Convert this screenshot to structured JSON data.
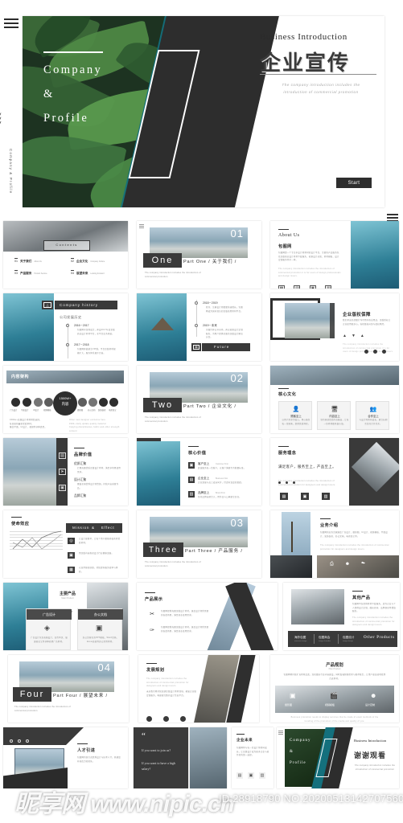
{
  "hero": {
    "brand_line1": "Company",
    "brand_line2": "&",
    "brand_line3": "Profile",
    "vertical_label": "Company  &  Profile",
    "chevrons": ">>>",
    "title_en": "Business Introduction",
    "title_cn": "企业宣传",
    "subtitle_line1": "The company introduction includes the",
    "subtitle_line2": "introduction of commercial promotion",
    "start_label": "Start"
  },
  "slides": {
    "contents": {
      "title": "Contents",
      "items": [
        {
          "no": "01",
          "cn": "关于我们",
          "en": "About Us"
        },
        {
          "no": "02",
          "cn": "企业文化",
          "en": "Company Culture"
        },
        {
          "no": "03",
          "cn": "产品服务",
          "en": "Product Service"
        },
        {
          "no": "04",
          "cn": "展望未来",
          "en": "Looking Forward"
        }
      ]
    },
    "part_one": {
      "number": "01",
      "word": "One",
      "caption": "Part One / 关于我们 /",
      "sub": "The company introduction includes the introduction of commercial promotion"
    },
    "about_us": {
      "title_en": "About Us",
      "title_cn": "包图网",
      "body": "包图网是一个专注于设计师素材的设计平台，主要的产品服务包括正版商业设计素材下载服务、创意设计灵感、素材模板、设计定制服务等于一体。",
      "body_en": "The company introduction includes the introduction of commercial promotion it is for users of design professionals and design lovers."
    },
    "history": {
      "title_en": "Company history",
      "title_cn": "公司发展历史",
      "future_label": "Future",
      "timeline": [
        {
          "year": "2016－2017",
          "text": "包图网于深圳成立，开设2017年度正版商业设计素材平台，全平台业务开始。"
        },
        {
          "year": "2017－2018",
          "text": "包图网开始建立VIP制，平台正版素材规模扩大，服务体系逐步完善。"
        },
        {
          "year": "2018－2019",
          "text": "签约、注册设计师数量快速增长，包图网成为国内领先的正版商用素材平台。"
        },
        {
          "year": "2019－未来",
          "text": "全面打开公众市场，开启创意设计定制服务，为用户提供全面的正版设计解决方案。"
        }
      ]
    },
    "copyright": {
      "title_cn": "企业版权保障",
      "body": "我们承诺全部图片均可用于商业用途，正版授权让企业使用更放心，杜绝版权纠纷与侵权风险。"
    },
    "structure": {
      "title_cn": "内容架构",
      "center_top": "1500W+",
      "center_bottom": "内容",
      "nodes_left": [
        "广告设计",
        "平面设计",
        "UI设计",
        "视频模板"
      ],
      "nodes_right": [
        "摄影图",
        "办公文档",
        "装饰装修",
        "电商淘宝"
      ],
      "notes_cn": [
        "1500w+正版设计素材供您选择。",
        "每日更新最新优质素材。",
        "覆盖平面、UI设计、视频等多种类型。"
      ],
      "notes_en": [
        "Other new designer exclusive here",
        "1500+ daily update quality material",
        "Copying disciplinaries, fabric and other strength content"
      ]
    },
    "part_two": {
      "number": "02",
      "word": "Two",
      "caption": "Part Two / 企业文化 /",
      "sub": "The company introduction includes the introduction of commercial promotion"
    },
    "core_culture": {
      "title_cn": "核心文化",
      "cards": [
        {
          "title": "顾客至上",
          "text": "以用户需求为核心，用心服务每一位顾客，提供优质体验。"
        },
        {
          "title": "内容至上",
          "text": "坚持原创优质内容输出，让每一份素材都具备价值。"
        },
        {
          "title": "合作至上",
          "text": "与设计师共同成长，建立长期互信的合作关系。"
        }
      ]
    },
    "brand_value": {
      "title_cn": "品牌价值",
      "items": [
        {
          "title": "优质汇聚",
          "text": "汇聚海量优质正版设计素材，满足多场景使用需求。"
        },
        {
          "title": "设计汇聚",
          "text": "聚集全国优秀设计师资源，持续产出创意作品。"
        },
        {
          "title": "品牌汇聚",
          "text": "与众多知名品牌深度合作，共建设计生态体系。"
        }
      ]
    },
    "core_value": {
      "title_cn": "核心价值",
      "items": [
        {
          "title": "客户至上",
          "en": "Customer First",
          "text": "真诚服务每一位客户，以客户满意作为衡量标准。"
        },
        {
          "title": "企业至上",
          "en": "Business First",
          "text": "企业发展与员工成长同步，打造有温度的组织。"
        },
        {
          "title": "品牌至上",
          "en": "Brand First",
          "text": "坚持品牌长期主义，用作品与口碑建立信任。"
        }
      ]
    },
    "service_idea": {
      "title_cn": "服务理念",
      "slogan": "满足客户，服务至上，产品至上。",
      "body_en": "The company introduction includes the introduction of commercial promotion for designers and design lovers."
    },
    "mission": {
      "title_cn": "使命效应",
      "banner_left": "Mission",
      "banner_amp": "&",
      "banner_right": "Effect",
      "items": [
        {
          "text": "让设计更简单，让每个用户都能轻松获得优质素材。"
        },
        {
          "text": "用正版内容推动设计行业健康发展。"
        },
        {
          "text": "以技术驱动创意，持续提升服务效率与体验。"
        }
      ]
    },
    "part_three": {
      "number": "03",
      "word": "Three",
      "caption": "Part Three / 产品服务 /",
      "sub": "The company introduction includes the introduction of commercial promotion"
    },
    "business_intro": {
      "title_cn": "业务介绍",
      "body": "包图网的业务范围涵盖广告设计、摄影图、UI设计、视频模板、平面设计、装饰装修、办公文档、电商淘宝等。",
      "body_en": "The company introduction includes the introduction of commercial promotion for designers and design lovers."
    },
    "main_products": {
      "title_cn": "主要产品",
      "title_en": "Main Product",
      "cards": [
        {
          "title": "广告设计",
          "text": "广告设计包含海报设计、宣传单页、展架易拉宝等多种商用广告素材。"
        },
        {
          "title": "办公文档",
          "text": "办公文档包含PPT模板、Word文档、Excel表格等办公常用素材。"
        }
      ]
    },
    "product_show": {
      "title_cn": "产品展示",
      "items": [
        {
          "text": "包图网提供海量正版设计素材，涵盖设计师所需要的各类场景，满足商业使用需求。"
        },
        {
          "text": "包图网提供海量正版设计素材，涵盖设计师所需要的各类场景，满足商业使用需求。"
        }
      ]
    },
    "other_products": {
      "title_cn": "其他产品",
      "body": "包图网不仅提供素材下载服务，还为企业与个人提供设计定制、版权咨询、品牌视觉等增值服务。",
      "body_en": "The company introduction includes the introduction of commercial promotion for designers and design lovers.",
      "bar_label": "Other Products",
      "bar_items": [
        {
          "cn": "海外包图",
          "en": "overseas image"
        },
        {
          "cn": "包图商会",
          "en": "image chamber"
        },
        {
          "cn": "包图设计",
          "en": "image design"
        }
      ]
    },
    "part_four": {
      "number": "04",
      "word": "Four",
      "caption": "Part Four / 展望未来 /",
      "sub": "The company introduction includes the introduction of commercial promotion"
    },
    "dev_plan": {
      "title_cn": "发展规划",
      "body_en": "The company introduction includes the introduction of commercial promotion for designers and design lovers.",
      "body_cn": "未来我们将持续深耕正版设计素材领域，拓展企业级定制服务，构建更完整的设计生态平台。"
    },
    "product_plan": {
      "title_cn": "产品规划",
      "title_en": "Plan Product",
      "body": "包图网将持续扩充素材品类，深化细分行业内容建设，同时加强智能检索与推荐能力，让用户更高效地找到合适素材。",
      "icons": [
        {
          "label": "摄影图"
        },
        {
          "label": "视频模板"
        },
        {
          "label": "设计定制"
        }
      ],
      "footer_en": "Business promotion needs to display services that be made of exact methods of the trending of the promotion of the media and quality of you."
    },
    "talent": {
      "title_cn": "人才引进",
      "body": "包图网持续引进优秀设计与技术人才，共建富有创造力的团队。"
    },
    "join_us": {
      "quote_mark": "“",
      "line1": "If you want to join us?",
      "line2": "If you want to have a high salary?"
    },
    "future": {
      "title_cn": "企业未来",
      "body": "包图网将与每一位设计师共同成长，让正版设计成为更多企业与创作者的第一选择。"
    },
    "thanks": {
      "brand_line1": "Company",
      "brand_line2": "&",
      "brand_line3": "Profile",
      "title_en": "Business Introduction",
      "title_cn": "谢谢观看",
      "subtitle": "The company introduction includes the introduction of commercial promotion"
    }
  },
  "watermark": {
    "site": "昵享网 www.nipic.cn",
    "id_text": "ID:28918790 NO:20200513142707560600"
  },
  "colors": {
    "dark": "#3a3a3a",
    "teal": "#14707d",
    "fern": "#2c4a2e",
    "muted": "#8e8e8e"
  }
}
